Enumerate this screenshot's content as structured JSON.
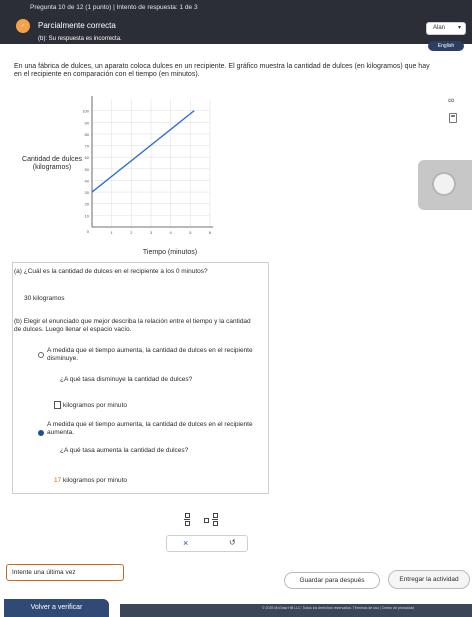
{
  "header": {
    "crumb": "Pregunta 10 de 12 (1 punto)  |  Intento de respuesta: 1 de 3",
    "status_icon": "partial-correct-badge",
    "status_title": "Parcialmente correcta",
    "status_sub": "(b): Su respuesta es incorrecta.",
    "user": "Alan",
    "language": "English"
  },
  "problem": {
    "intro": "En una fábrica de dulces, un aparato coloca dulces en un recipiente. El gráfico muestra la cantidad de dulces (en kilogramos) que hay en el recipiente en comparación con el tiempo (en minutos)."
  },
  "chart_data": {
    "type": "line",
    "xlabel": "Tiempo (minutos)",
    "ylabel": "Cantidad de dulces (kilogramos)",
    "xlim": [
      0,
      6
    ],
    "ylim": [
      0,
      110
    ],
    "xticks": [
      1,
      2,
      3,
      4,
      5,
      6
    ],
    "yticks": [
      10,
      20,
      30,
      40,
      50,
      60,
      70,
      80,
      90,
      100
    ],
    "grid": true,
    "series": [
      {
        "x": [
          0,
          5.2
        ],
        "y": [
          30,
          100
        ],
        "color": "#2f6fdb"
      }
    ]
  },
  "part_a": {
    "question": "(a) ¿Cuál es la cantidad de dulces en el recipiente a los 0 minutos?",
    "answer_value": "30",
    "answer_unit": "kilogramos"
  },
  "part_b": {
    "question": "(b) Elegir el enunciado que mejor describa la relación entre el tiempo y la cantidad de dulces. Luego llenar el espacio vacío.",
    "option1": "A medida que el tiempo aumenta, la cantidad de dulces en el recipiente disminuye.",
    "option1_sub": "¿A qué tasa disminuye la cantidad de dulces?",
    "option1_unit": "kilogramos por minuto",
    "option2": "A medida que el tiempo aumenta, la cantidad de dulces en el recipiente aumenta.",
    "option2_sub": "¿A qué tasa aumenta la cantidad de dulces?",
    "option2_value": "17",
    "option2_unit": "kilogramos por minuto"
  },
  "tools": {
    "clear": "×",
    "undo": "↺"
  },
  "footer": {
    "try_again": "Intente una última vez",
    "back": "Volver a verificar",
    "save": "Guardar para después",
    "submit": "Entregar la actividad",
    "legal": "© 2025 McGraw Hill LLC. Todos los derechos reservados.  Términos de uso  |  Centro de privacidad"
  }
}
